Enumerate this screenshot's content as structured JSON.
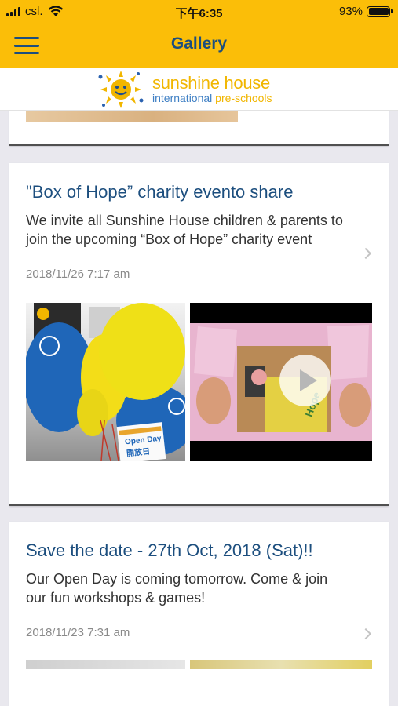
{
  "status_bar": {
    "carrier": "csl.",
    "time": "下午6:35",
    "battery": "93%"
  },
  "nav": {
    "title": "Gallery",
    "menu_icon": "hamburger-menu-icon"
  },
  "logo": {
    "line1": "sunshine house",
    "line2a": "international",
    "line2b": "pre-schools",
    "icon": "sun-logo-icon"
  },
  "posts": [
    {
      "title": "\"Box of Hope” charity evento share",
      "body": "We invite all Sunshine House children & parents to join the upcoming “Box of Hope” charity event",
      "date": "2018/11/26  7:17 am",
      "thumb_card_line1": "Open Day",
      "thumb_card_line2": "開放日",
      "thumb_box_text": "Hope"
    },
    {
      "title": "Save the date - 27th Oct, 2018 (Sat)!!",
      "body": "Our Open Day is coming tomorrow. Come & join our fun workshops & games!",
      "date": "2018/11/23  7:31 am"
    }
  ],
  "colors": {
    "brand_yellow": "#fbbe08",
    "brand_blue": "#1c4e7e",
    "logo_blue": "#3e7fc4"
  }
}
